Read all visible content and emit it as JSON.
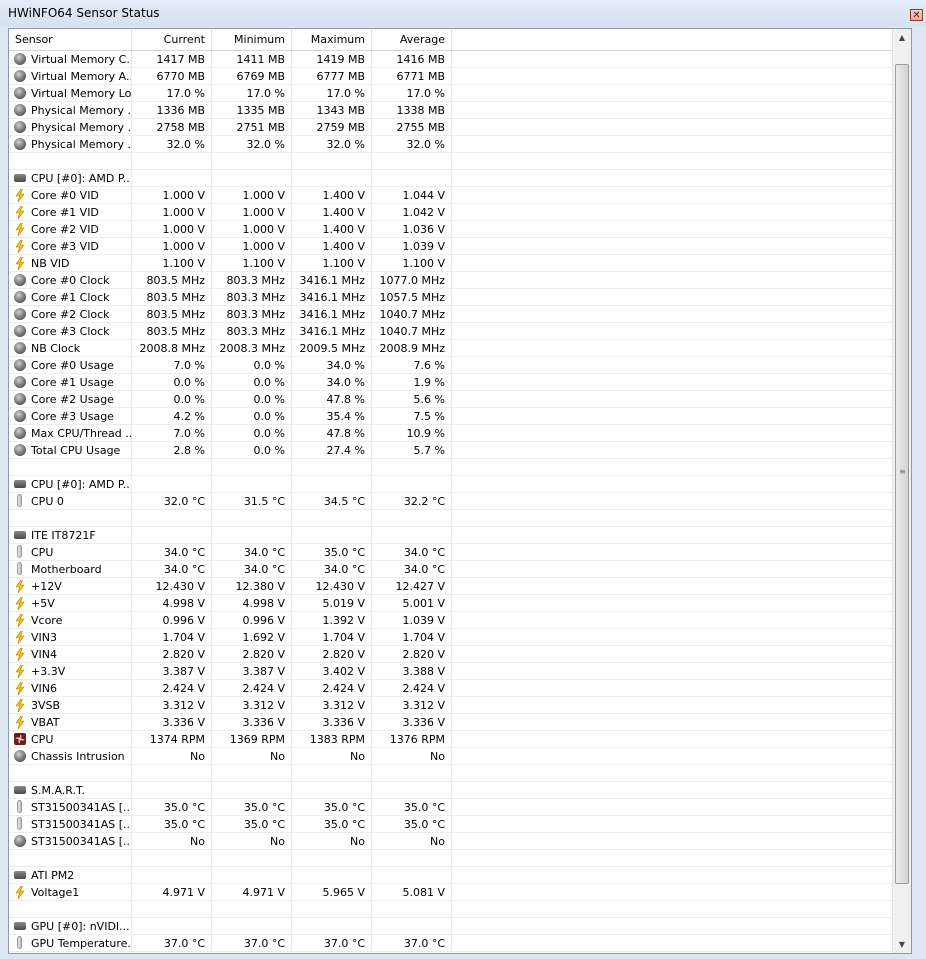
{
  "window": {
    "title": "HWiNFO64 Sensor Status",
    "close_label": "✕"
  },
  "columns": {
    "sensor": "Sensor",
    "current": "Current",
    "minimum": "Minimum",
    "maximum": "Maximum",
    "average": "Average"
  },
  "rows": [
    {
      "type": "sensor",
      "icon": "gauge-icon",
      "name": "Virtual Memory C...",
      "cur": "1417 MB",
      "min": "1411 MB",
      "max": "1419 MB",
      "avg": "1416 MB"
    },
    {
      "type": "sensor",
      "icon": "gauge-icon",
      "name": "Virtual Memory A...",
      "cur": "6770 MB",
      "min": "6769 MB",
      "max": "6777 MB",
      "avg": "6771 MB"
    },
    {
      "type": "sensor",
      "icon": "gauge-icon",
      "name": "Virtual Memory Load",
      "cur": "17.0 %",
      "min": "17.0 %",
      "max": "17.0 %",
      "avg": "17.0 %"
    },
    {
      "type": "sensor",
      "icon": "gauge-icon",
      "name": "Physical Memory ...",
      "cur": "1336 MB",
      "min": "1335 MB",
      "max": "1343 MB",
      "avg": "1338 MB"
    },
    {
      "type": "sensor",
      "icon": "gauge-icon",
      "name": "Physical Memory ...",
      "cur": "2758 MB",
      "min": "2751 MB",
      "max": "2759 MB",
      "avg": "2755 MB"
    },
    {
      "type": "sensor",
      "icon": "gauge-icon",
      "name": "Physical Memory ...",
      "cur": "32.0 %",
      "min": "32.0 %",
      "max": "32.0 %",
      "avg": "32.0 %"
    },
    {
      "type": "blank"
    },
    {
      "type": "group",
      "icon": "chip-icon",
      "name": "CPU [#0]: AMD P..."
    },
    {
      "type": "sensor",
      "icon": "bolt-icon",
      "name": "Core #0 VID",
      "cur": "1.000 V",
      "min": "1.000 V",
      "max": "1.400 V",
      "avg": "1.044 V"
    },
    {
      "type": "sensor",
      "icon": "bolt-icon",
      "name": "Core #1 VID",
      "cur": "1.000 V",
      "min": "1.000 V",
      "max": "1.400 V",
      "avg": "1.042 V"
    },
    {
      "type": "sensor",
      "icon": "bolt-icon",
      "name": "Core #2 VID",
      "cur": "1.000 V",
      "min": "1.000 V",
      "max": "1.400 V",
      "avg": "1.036 V"
    },
    {
      "type": "sensor",
      "icon": "bolt-icon",
      "name": "Core #3 VID",
      "cur": "1.000 V",
      "min": "1.000 V",
      "max": "1.400 V",
      "avg": "1.039 V"
    },
    {
      "type": "sensor",
      "icon": "bolt-icon",
      "name": "NB VID",
      "cur": "1.100 V",
      "min": "1.100 V",
      "max": "1.100 V",
      "avg": "1.100 V"
    },
    {
      "type": "sensor",
      "icon": "gauge-icon",
      "name": "Core #0 Clock",
      "cur": "803.5 MHz",
      "min": "803.3 MHz",
      "max": "3416.1 MHz",
      "avg": "1077.0 MHz"
    },
    {
      "type": "sensor",
      "icon": "gauge-icon",
      "name": "Core #1 Clock",
      "cur": "803.5 MHz",
      "min": "803.3 MHz",
      "max": "3416.1 MHz",
      "avg": "1057.5 MHz"
    },
    {
      "type": "sensor",
      "icon": "gauge-icon",
      "name": "Core #2 Clock",
      "cur": "803.5 MHz",
      "min": "803.3 MHz",
      "max": "3416.1 MHz",
      "avg": "1040.7 MHz"
    },
    {
      "type": "sensor",
      "icon": "gauge-icon",
      "name": "Core #3 Clock",
      "cur": "803.5 MHz",
      "min": "803.3 MHz",
      "max": "3416.1 MHz",
      "avg": "1040.7 MHz"
    },
    {
      "type": "sensor",
      "icon": "gauge-icon",
      "name": "NB Clock",
      "cur": "2008.8 MHz",
      "min": "2008.3 MHz",
      "max": "2009.5 MHz",
      "avg": "2008.9 MHz"
    },
    {
      "type": "sensor",
      "icon": "gauge-icon",
      "name": "Core #0 Usage",
      "cur": "7.0 %",
      "min": "0.0 %",
      "max": "34.0 %",
      "avg": "7.6 %"
    },
    {
      "type": "sensor",
      "icon": "gauge-icon",
      "name": "Core #1 Usage",
      "cur": "0.0 %",
      "min": "0.0 %",
      "max": "34.0 %",
      "avg": "1.9 %"
    },
    {
      "type": "sensor",
      "icon": "gauge-icon",
      "name": "Core #2 Usage",
      "cur": "0.0 %",
      "min": "0.0 %",
      "max": "47.8 %",
      "avg": "5.6 %"
    },
    {
      "type": "sensor",
      "icon": "gauge-icon",
      "name": "Core #3 Usage",
      "cur": "4.2 %",
      "min": "0.0 %",
      "max": "35.4 %",
      "avg": "7.5 %"
    },
    {
      "type": "sensor",
      "icon": "gauge-icon",
      "name": "Max CPU/Thread ...",
      "cur": "7.0 %",
      "min": "0.0 %",
      "max": "47.8 %",
      "avg": "10.9 %"
    },
    {
      "type": "sensor",
      "icon": "gauge-icon",
      "name": "Total CPU Usage",
      "cur": "2.8 %",
      "min": "0.0 %",
      "max": "27.4 %",
      "avg": "5.7 %"
    },
    {
      "type": "blank"
    },
    {
      "type": "group",
      "icon": "chip-icon",
      "name": "CPU [#0]: AMD P..."
    },
    {
      "type": "sensor",
      "icon": "thermometer-icon",
      "name": "CPU 0",
      "cur": "32.0 °C",
      "min": "31.5 °C",
      "max": "34.5 °C",
      "avg": "32.2 °C"
    },
    {
      "type": "blank"
    },
    {
      "type": "group",
      "icon": "chip-icon",
      "name": "ITE IT8721F"
    },
    {
      "type": "sensor",
      "icon": "thermometer-icon",
      "name": "CPU",
      "cur": "34.0 °C",
      "min": "34.0 °C",
      "max": "35.0 °C",
      "avg": "34.0 °C"
    },
    {
      "type": "sensor",
      "icon": "thermometer-icon",
      "name": "Motherboard",
      "cur": "34.0 °C",
      "min": "34.0 °C",
      "max": "34.0 °C",
      "avg": "34.0 °C"
    },
    {
      "type": "sensor",
      "icon": "bolt-icon",
      "name": "+12V",
      "cur": "12.430 V",
      "min": "12.380 V",
      "max": "12.430 V",
      "avg": "12.427 V"
    },
    {
      "type": "sensor",
      "icon": "bolt-icon",
      "name": "+5V",
      "cur": "4.998 V",
      "min": "4.998 V",
      "max": "5.019 V",
      "avg": "5.001 V"
    },
    {
      "type": "sensor",
      "icon": "bolt-icon",
      "name": "Vcore",
      "cur": "0.996 V",
      "min": "0.996 V",
      "max": "1.392 V",
      "avg": "1.039 V"
    },
    {
      "type": "sensor",
      "icon": "bolt-icon",
      "name": "VIN3",
      "cur": "1.704 V",
      "min": "1.692 V",
      "max": "1.704 V",
      "avg": "1.704 V"
    },
    {
      "type": "sensor",
      "icon": "bolt-icon",
      "name": "VIN4",
      "cur": "2.820 V",
      "min": "2.820 V",
      "max": "2.820 V",
      "avg": "2.820 V"
    },
    {
      "type": "sensor",
      "icon": "bolt-icon",
      "name": "+3.3V",
      "cur": "3.387 V",
      "min": "3.387 V",
      "max": "3.402 V",
      "avg": "3.388 V"
    },
    {
      "type": "sensor",
      "icon": "bolt-icon",
      "name": "VIN6",
      "cur": "2.424 V",
      "min": "2.424 V",
      "max": "2.424 V",
      "avg": "2.424 V"
    },
    {
      "type": "sensor",
      "icon": "bolt-icon",
      "name": "3VSB",
      "cur": "3.312 V",
      "min": "3.312 V",
      "max": "3.312 V",
      "avg": "3.312 V"
    },
    {
      "type": "sensor",
      "icon": "bolt-icon",
      "name": "VBAT",
      "cur": "3.336 V",
      "min": "3.336 V",
      "max": "3.336 V",
      "avg": "3.336 V"
    },
    {
      "type": "sensor",
      "icon": "fan-icon",
      "name": "CPU",
      "cur": "1374 RPM",
      "min": "1369 RPM",
      "max": "1383 RPM",
      "avg": "1376 RPM"
    },
    {
      "type": "sensor",
      "icon": "gauge-icon",
      "name": "Chassis Intrusion",
      "cur": "No",
      "min": "No",
      "max": "No",
      "avg": "No"
    },
    {
      "type": "blank"
    },
    {
      "type": "group",
      "icon": "chip-icon",
      "name": "S.M.A.R.T."
    },
    {
      "type": "sensor",
      "icon": "thermometer-icon",
      "name": "ST31500341AS [...",
      "cur": "35.0 °C",
      "min": "35.0 °C",
      "max": "35.0 °C",
      "avg": "35.0 °C"
    },
    {
      "type": "sensor",
      "icon": "thermometer-icon",
      "name": "ST31500341AS [...",
      "cur": "35.0 °C",
      "min": "35.0 °C",
      "max": "35.0 °C",
      "avg": "35.0 °C"
    },
    {
      "type": "sensor",
      "icon": "gauge-icon",
      "name": "ST31500341AS [...",
      "cur": "No",
      "min": "No",
      "max": "No",
      "avg": "No"
    },
    {
      "type": "blank"
    },
    {
      "type": "group",
      "icon": "chip-icon",
      "name": "ATI PM2"
    },
    {
      "type": "sensor",
      "icon": "bolt-icon",
      "name": "Voltage1",
      "cur": "4.971 V",
      "min": "4.971 V",
      "max": "5.965 V",
      "avg": "5.081 V"
    },
    {
      "type": "blank"
    },
    {
      "type": "group",
      "icon": "chip-icon",
      "name": "GPU [#0]: nVIDI..."
    },
    {
      "type": "sensor",
      "icon": "thermometer-icon",
      "name": "GPU Temperature...",
      "cur": "37.0 °C",
      "min": "37.0 °C",
      "max": "37.0 °C",
      "avg": "37.0 °C"
    }
  ],
  "scrollbar": {
    "up_arrow": "▲",
    "down_arrow": "▼",
    "grip": "≡"
  }
}
